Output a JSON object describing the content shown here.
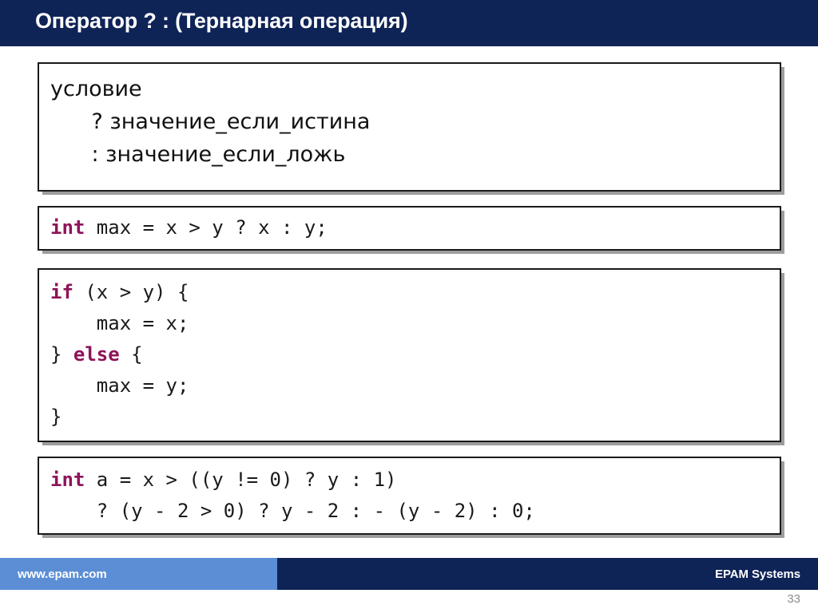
{
  "slide": {
    "title": "Оператор ? : (Тернарная операция)",
    "page_number": "33",
    "header_color": "#0e2356",
    "keyword_color": "#8d1458",
    "footer_accent_color": "#5b8ed4"
  },
  "blocks": [
    {
      "id": "syntax-template",
      "kind": "pseudo",
      "lines": [
        "условие",
        "      ? значение_если_истина",
        "      : значение_если_ложь"
      ]
    },
    {
      "id": "ternary-example",
      "kind": "code",
      "lines": [
        {
          "keyword": "int",
          "rest": " max = x > y ? x : y;"
        }
      ]
    },
    {
      "id": "if-else-equivalent",
      "kind": "code",
      "lines": [
        {
          "keyword": "if",
          "rest": " (x > y) {"
        },
        {
          "keyword": "",
          "rest": "    max = x;"
        },
        {
          "keyword": "",
          "rest": "} ",
          "keyword2": "else",
          "rest2": " {"
        },
        {
          "keyword": "",
          "rest": "    max = y;"
        },
        {
          "keyword": "",
          "rest": "}"
        }
      ]
    },
    {
      "id": "nested-ternary-example",
      "kind": "code",
      "lines": [
        {
          "keyword": "int",
          "rest": " a = x > ((y != 0) ? y : 1)"
        },
        {
          "keyword": "",
          "rest": "    ? (y - 2 > 0) ? y - 2 : - (y - 2) : 0;"
        }
      ]
    }
  ],
  "footer": {
    "url": "www.epam.com",
    "brand": "EPAM Systems"
  },
  "text": {
    "b1_l1": "условие",
    "b1_l2": "      ? значение_если_истина",
    "b1_l3": "      : значение_если_ложь",
    "b2_kw": "int",
    "b2_rest": " max = x > y ? x : y;",
    "b3_l1_kw": "if",
    "b3_l1_rest": " (x > y) {",
    "b3_l2": "    max = x;",
    "b3_l3_a": "} ",
    "b3_l3_kw": "else",
    "b3_l3_b": " {",
    "b3_l4": "    max = y;",
    "b3_l5": "}",
    "b4_l1_kw": "int",
    "b4_l1_rest": " a = x > ((y != 0) ? y : 1)",
    "b4_l2": "    ? (y - 2 > 0) ? y - 2 : - (y - 2) : 0;"
  }
}
